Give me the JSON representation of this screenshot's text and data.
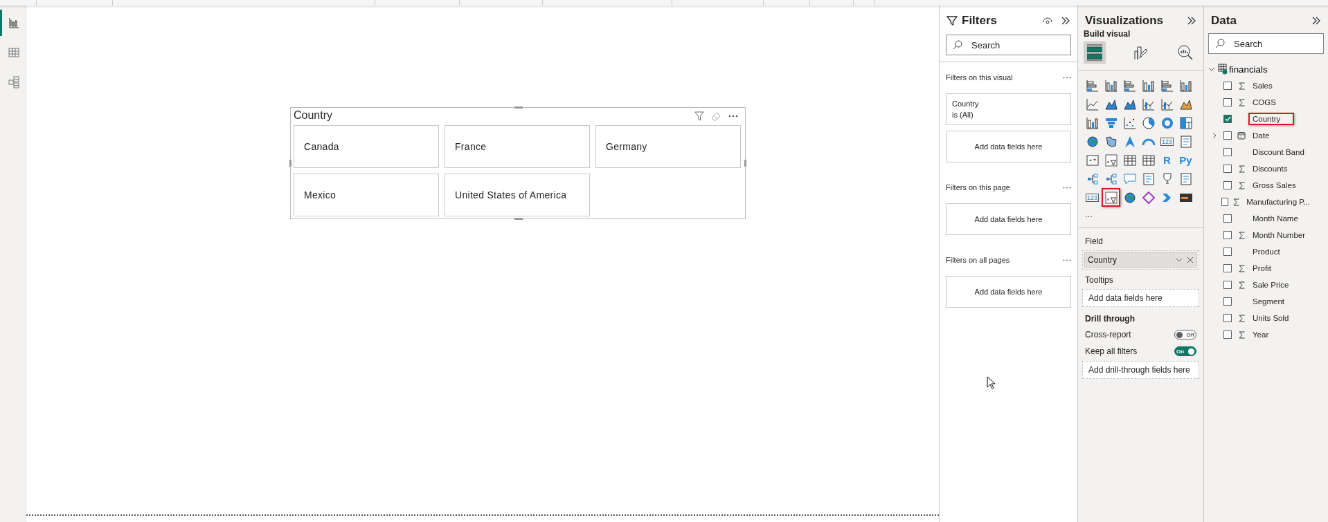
{
  "nav": [
    {
      "kind": "report",
      "selected": true
    },
    {
      "kind": "table",
      "selected": false
    },
    {
      "kind": "model",
      "selected": false
    }
  ],
  "slicer": {
    "title": "Country",
    "tiles": [
      "Canada",
      "France",
      "Germany",
      "Mexico",
      "United States of America"
    ]
  },
  "filters": {
    "title": "Filters",
    "search": {
      "placeholder": "Search"
    },
    "sections": [
      {
        "title": "Filters on this visual",
        "cards": [
          {
            "kind": "filter",
            "field": "Country",
            "state": "is (All)"
          },
          {
            "kind": "drop",
            "text": "Add data fields here"
          }
        ]
      },
      {
        "title": "Filters on this page",
        "cards": [
          {
            "kind": "drop",
            "text": "Add data fields here"
          }
        ]
      },
      {
        "title": "Filters on all pages",
        "cards": [
          {
            "kind": "drop",
            "text": "Add data fields here"
          }
        ]
      }
    ]
  },
  "visualizations": {
    "title": "Visualizations",
    "subtitle": "Build visual",
    "tabs": [
      {
        "kind": "build",
        "selected": true
      },
      {
        "kind": "format",
        "selected": false
      },
      {
        "kind": "analytics",
        "selected": false
      }
    ],
    "visual_types": [
      {
        "kind": "hbar",
        "selected": false
      },
      {
        "kind": "column",
        "selected": false
      },
      {
        "kind": "hbar",
        "selected": false
      },
      {
        "kind": "column",
        "selected": false
      },
      {
        "kind": "hbar",
        "selected": false
      },
      {
        "kind": "column",
        "selected": false
      },
      {
        "kind": "line",
        "selected": false
      },
      {
        "kind": "area",
        "selected": false
      },
      {
        "kind": "area",
        "selected": false
      },
      {
        "kind": "combo",
        "selected": false
      },
      {
        "kind": "combo",
        "selected": false
      },
      {
        "kind": "ribbon",
        "selected": false
      },
      {
        "kind": "column",
        "selected": false
      },
      {
        "kind": "funnel",
        "selected": false
      },
      {
        "kind": "scatter",
        "selected": false
      },
      {
        "kind": "pie",
        "selected": false
      },
      {
        "kind": "donut",
        "selected": false
      },
      {
        "kind": "treemap",
        "selected": false
      },
      {
        "kind": "globe",
        "selected": false
      },
      {
        "kind": "map",
        "selected": false
      },
      {
        "kind": "arrow",
        "selected": false
      },
      {
        "kind": "gauge",
        "selected": false
      },
      {
        "kind": "glyph",
        "label": "123",
        "selected": false
      },
      {
        "kind": "list",
        "selected": false
      },
      {
        "kind": "kpi",
        "selected": false
      },
      {
        "kind": "slicer",
        "selected": false
      },
      {
        "kind": "table",
        "selected": false
      },
      {
        "kind": "table",
        "selected": false
      },
      {
        "kind": "glyph",
        "label": "R",
        "selected": false
      },
      {
        "kind": "glyph",
        "label": "Py",
        "selected": false
      },
      {
        "kind": "tree",
        "selected": false
      },
      {
        "kind": "tree",
        "selected": false
      },
      {
        "kind": "bubble",
        "selected": false
      },
      {
        "kind": "doc",
        "selected": false
      },
      {
        "kind": "trophy",
        "selected": false
      },
      {
        "kind": "doc",
        "selected": false
      },
      {
        "kind": "glyph",
        "label": "123",
        "selected": false
      },
      {
        "kind": "slicer",
        "selected": true
      },
      {
        "kind": "globe",
        "selected": false
      },
      {
        "kind": "diamond",
        "selected": false
      },
      {
        "kind": "chevron",
        "selected": false
      },
      {
        "kind": "bar-dark",
        "selected": false
      }
    ],
    "more": "...",
    "wells": [
      {
        "label": "Field",
        "kind": "filled",
        "value": "Country"
      },
      {
        "label": "Tooltips",
        "kind": "empty",
        "value": "Add data fields here"
      }
    ],
    "drill_through": {
      "title": "Drill through",
      "toggles": [
        {
          "label": "Cross-report",
          "on": false,
          "text": "Off"
        },
        {
          "label": "Keep all filters",
          "on": true,
          "text": "On"
        }
      ],
      "well": "Add drill-through fields here"
    }
  },
  "data": {
    "title": "Data",
    "search": {
      "placeholder": "Search"
    },
    "table": {
      "name": "financials",
      "expanded": true,
      "fields": [
        {
          "name": "Sales",
          "kind": "measure",
          "checked": false,
          "highlighted": false
        },
        {
          "name": "COGS",
          "kind": "measure",
          "checked": false,
          "highlighted": false
        },
        {
          "name": "Country",
          "kind": "text",
          "checked": true,
          "highlighted": true
        },
        {
          "name": "Date",
          "kind": "date",
          "checked": false,
          "highlighted": false,
          "expanded": false
        },
        {
          "name": "Discount Band",
          "kind": "text",
          "checked": false,
          "highlighted": false
        },
        {
          "name": "Discounts",
          "kind": "measure",
          "checked": false,
          "highlighted": false
        },
        {
          "name": "Gross Sales",
          "kind": "measure",
          "checked": false,
          "highlighted": false
        },
        {
          "name": "Manufacturing P...",
          "kind": "measure",
          "checked": false,
          "highlighted": false
        },
        {
          "name": "Month Name",
          "kind": "text",
          "checked": false,
          "highlighted": false
        },
        {
          "name": "Month Number",
          "kind": "measure",
          "checked": false,
          "highlighted": false
        },
        {
          "name": "Product",
          "kind": "text",
          "checked": false,
          "highlighted": false
        },
        {
          "name": "Profit",
          "kind": "measure",
          "checked": false,
          "highlighted": false
        },
        {
          "name": "Sale Price",
          "kind": "measure",
          "checked": false,
          "highlighted": false
        },
        {
          "name": "Segment",
          "kind": "text",
          "checked": false,
          "highlighted": false
        },
        {
          "name": "Units Sold",
          "kind": "measure",
          "checked": false,
          "highlighted": false
        },
        {
          "name": "Year",
          "kind": "measure",
          "checked": false,
          "highlighted": false
        }
      ]
    }
  }
}
